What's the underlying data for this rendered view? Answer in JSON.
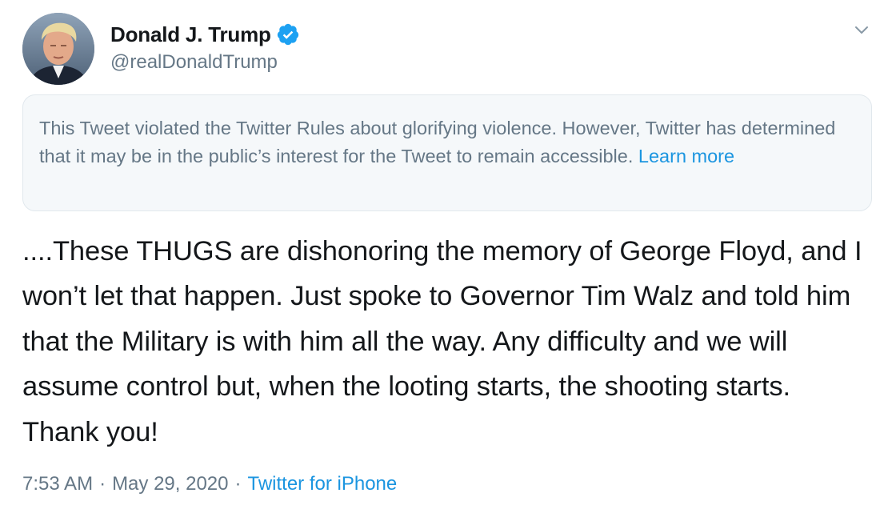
{
  "author": {
    "display_name": "Donald J. Trump",
    "handle": "@realDonaldTrump",
    "verified": true,
    "avatar_icon": "profile-avatar",
    "verified_icon": "verified-badge-icon"
  },
  "menu": {
    "icon": "chevron-down-icon"
  },
  "notice": {
    "text": "This Tweet violated the Twitter Rules about glorifying violence. However, Twitter has determined that it may be in the public’s interest for the Tweet to remain accessible. ",
    "link_label": "Learn more"
  },
  "tweet": {
    "text": "....These THUGS are dishonoring the memory of George Floyd, and I won’t let that happen. Just spoke to Governor Tim Walz and told him that the Military is with him all the way. Any difficulty and we will assume control but, when the looting starts, the shooting starts. Thank you!"
  },
  "meta": {
    "time": "7:53 AM",
    "separator": "·",
    "date": "May 29, 2020",
    "source": "Twitter for iPhone"
  },
  "colors": {
    "link": "#1b95e0",
    "secondary_text": "#657786",
    "notice_background": "#f5f8fa",
    "notice_border": "#e1e8ed",
    "verified_badge": "#1da1f2"
  }
}
